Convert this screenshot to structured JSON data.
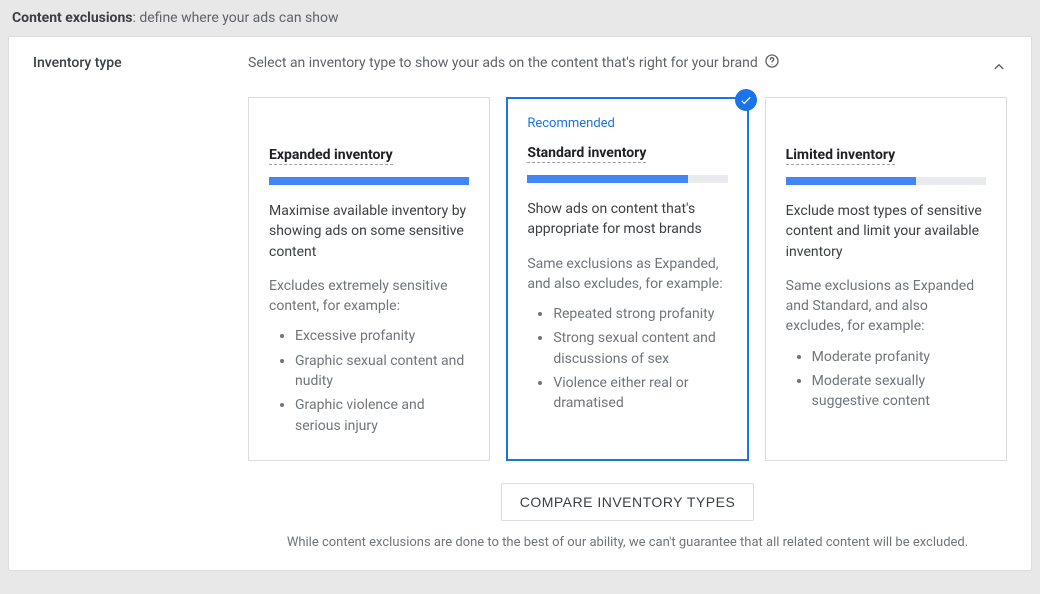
{
  "header": {
    "title_bold": "Content exclusions",
    "title_rest": ": define where your ads can show"
  },
  "section": {
    "label": "Inventory type",
    "description": "Select an inventory type to show your ads on the content that's right for your brand"
  },
  "cards": [
    {
      "recommended": "",
      "title": "Expanded inventory",
      "bar_pct": 100,
      "subtitle": "Maximise available inventory by showing ads on some sensitive content",
      "exclusion_intro": "Excludes extremely sensitive content, for example:",
      "bullets": [
        "Excessive profanity",
        "Graphic sexual content and nudity",
        "Graphic violence and serious injury"
      ],
      "selected": false
    },
    {
      "recommended": "Recommended",
      "title": "Standard inventory",
      "bar_pct": 80,
      "subtitle": "Show ads on content that's appropriate for most brands",
      "exclusion_intro": "Same exclusions as Expanded, and also excludes, for example:",
      "bullets": [
        "Repeated strong profanity",
        "Strong sexual content and discussions of sex",
        "Violence either real or dramatised"
      ],
      "selected": true
    },
    {
      "recommended": "",
      "title": "Limited inventory",
      "bar_pct": 65,
      "subtitle": "Exclude most types of sensitive content and limit your available inventory",
      "exclusion_intro": "Same exclusions as Expanded and Standard, and also excludes, for example:",
      "bullets": [
        "Moderate profanity",
        "Moderate sexually suggestive content"
      ],
      "selected": false
    }
  ],
  "compare_button": "COMPARE INVENTORY TYPES",
  "disclaimer": "While content exclusions are done to the best of our ability, we can't guarantee that all related content will be excluded."
}
